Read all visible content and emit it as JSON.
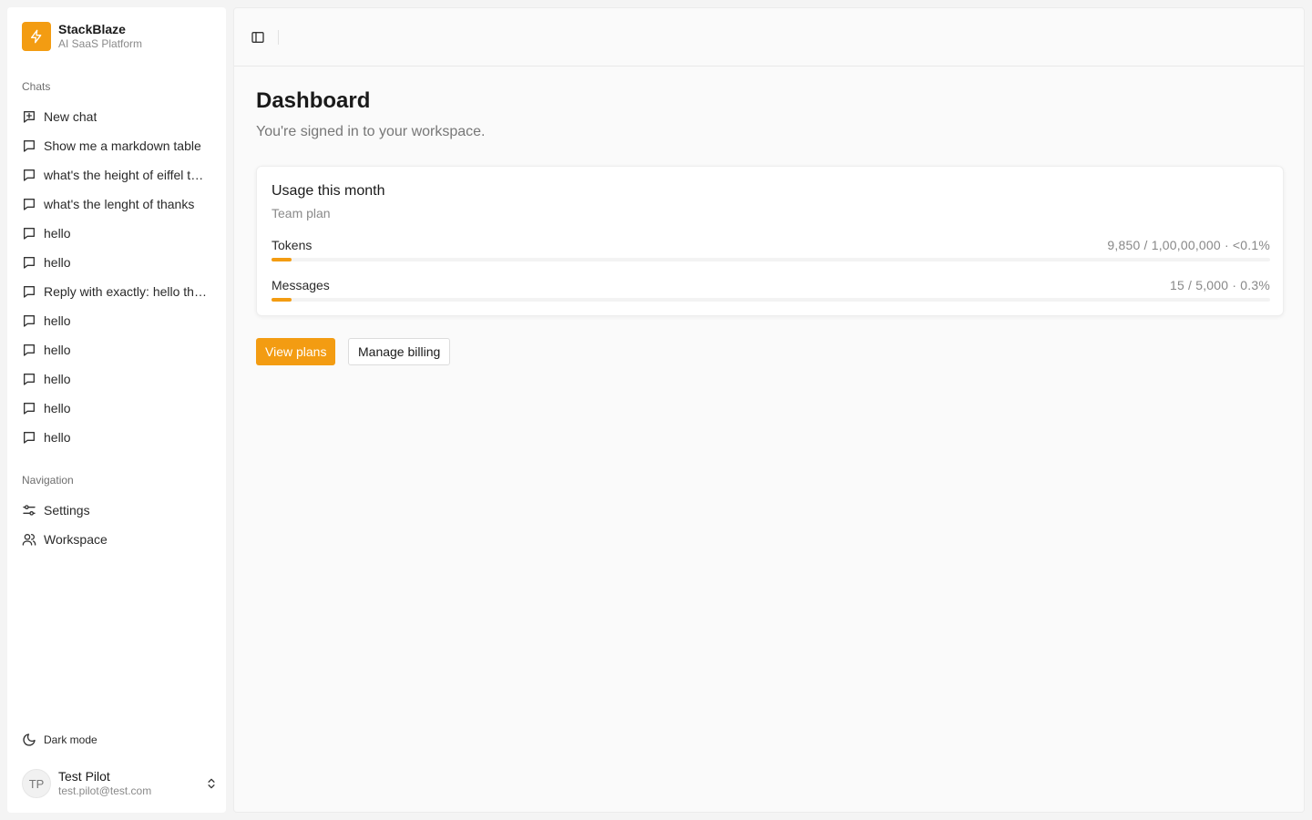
{
  "brand": {
    "name": "StackBlaze",
    "subtitle": "AI SaaS Platform"
  },
  "sidebar": {
    "chats_label": "Chats",
    "chats": [
      {
        "label": "New chat",
        "icon": "square-plus-icon"
      },
      {
        "label": "Show me a markdown table",
        "icon": "message-square-icon"
      },
      {
        "label": "what's the height of eiffel tower",
        "icon": "message-square-icon"
      },
      {
        "label": "what's the lenght of thanks",
        "icon": "message-square-icon"
      },
      {
        "label": "hello",
        "icon": "message-square-icon"
      },
      {
        "label": "hello",
        "icon": "message-square-icon"
      },
      {
        "label": "Reply with exactly: hello there",
        "icon": "message-square-icon"
      },
      {
        "label": "hello",
        "icon": "message-square-icon"
      },
      {
        "label": "hello",
        "icon": "message-square-icon"
      },
      {
        "label": "hello",
        "icon": "message-square-icon"
      },
      {
        "label": "hello",
        "icon": "message-square-icon"
      },
      {
        "label": "hello",
        "icon": "message-square-icon"
      }
    ],
    "navigation_label": "Navigation",
    "navigation": [
      {
        "label": "Settings",
        "icon": "sliders-icon"
      },
      {
        "label": "Workspace",
        "icon": "users-icon"
      }
    ],
    "dark_mode_label": "Dark mode"
  },
  "user": {
    "initials": "TP",
    "name": "Test Pilot",
    "email": "test.pilot@test.com"
  },
  "main": {
    "title": "Dashboard",
    "subtitle": "You're signed in to your workspace.",
    "usage": {
      "title": "Usage this month",
      "plan": "Team plan",
      "tokens": {
        "label": "Tokens",
        "value": "9,850 / 1,00,00,000 · <0.1%",
        "fill_percent": 2
      },
      "messages": {
        "label": "Messages",
        "value": "15 / 5,000 · 0.3%",
        "fill_percent": 2
      }
    },
    "view_plans_label": "View plans",
    "manage_billing_label": "Manage billing"
  },
  "colors": {
    "accent": "#f39c12"
  }
}
